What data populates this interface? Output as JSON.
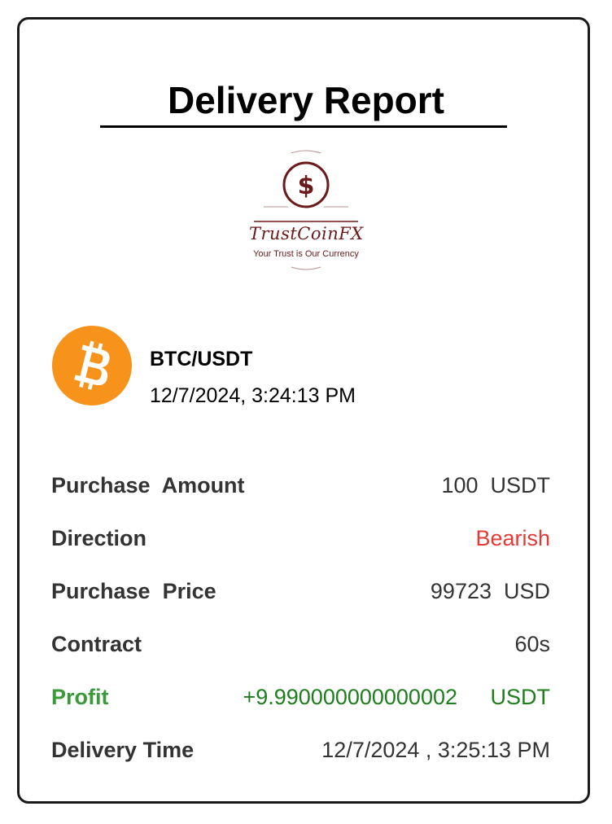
{
  "report": {
    "title": "Delivery Report"
  },
  "logo": {
    "name": "TrustCoinFX",
    "tagline": "Your Trust is Our Currency",
    "icon": "dollar-coin-icon",
    "color": "#6a1a1a"
  },
  "trade": {
    "coin_icon": "bitcoin-icon",
    "coin_color": "#f7931a",
    "pair": "BTC/USDT",
    "timestamp": "12/7/2024, 3:24:13 PM"
  },
  "details": {
    "purchase_amount_label": "Purchase  Amount",
    "purchase_amount_value": "100  USDT",
    "direction_label": "Direction",
    "direction_value": "Bearish",
    "purchase_price_label": "Purchase  Price",
    "purchase_price_value": "99723  USD",
    "contract_label": "Contract",
    "contract_value": "60s",
    "profit_label": "Profit",
    "profit_amount": "+9.990000000000002",
    "profit_unit": "USDT",
    "delivery_time_label": "Delivery Time",
    "delivery_time_value": "12/7/2024 , 3:25:13 PM"
  },
  "colors": {
    "bearish": "#e53935",
    "profit": "#1e7e1e",
    "profit_label": "#3a9a3a"
  }
}
